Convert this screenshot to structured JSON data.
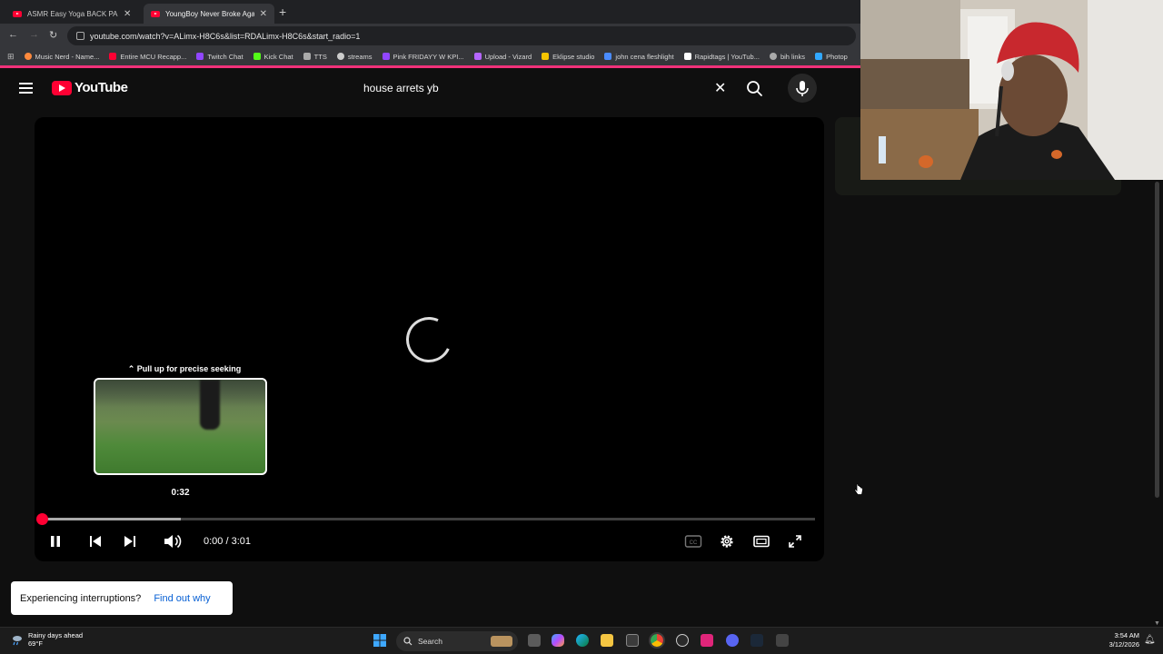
{
  "browser": {
    "tabs": [
      {
        "label": "ASMR Easy Yoga BACK PAIN RE",
        "active": false
      },
      {
        "label": "YoungBoy Never Broke Again -",
        "active": true
      }
    ],
    "new_tab": "+",
    "url": "youtube.com/watch?v=ALimx-H8C6s&list=RDALimx-H8C6s&start_radio=1",
    "bookmarks": [
      {
        "label": "Music Nerd - Name...",
        "color": "#ff8a3d"
      },
      {
        "label": "Entire MCU Recapp...",
        "color": "#ff0033"
      },
      {
        "label": "Twitch Chat",
        "color": "#9146ff"
      },
      {
        "label": "Kick Chat",
        "color": "#53fc18"
      },
      {
        "label": "TTS",
        "color": "#aaaaaa"
      },
      {
        "label": "streams",
        "color": "#cccccc"
      },
      {
        "label": "Pink FRIDAYY W KPI...",
        "color": "#9146ff"
      },
      {
        "label": "Upload - Vizard",
        "color": "#b566ff"
      },
      {
        "label": "Eklipse studio",
        "color": "#f5c400"
      },
      {
        "label": "john cena fleshlight",
        "color": "#4a8cff"
      },
      {
        "label": "Rapidtags | YouTub...",
        "color": "#ffffff"
      },
      {
        "label": "bih links",
        "color": "#aaaaaa"
      },
      {
        "label": "Photop",
        "color": "#31a8ff"
      }
    ]
  },
  "youtube": {
    "logo_text": "YouTube",
    "search_query": "house arrets yb"
  },
  "player": {
    "seek_hint": "Pull up for precise seeking",
    "preview_time": "0:32",
    "current_time": "0:00",
    "duration": "3:01",
    "time_display": "0:00 / 3:01",
    "buffered_fraction": 0.18,
    "played_fraction": 0.0
  },
  "toast": {
    "message": "Experiencing interruptions?",
    "link": "Find out why"
  },
  "taskbar": {
    "weather_title": "Rainy days ahead",
    "weather_temp": "69°F",
    "search_label": "Search",
    "time": "3:54 AM",
    "date": "3/12/2026"
  }
}
